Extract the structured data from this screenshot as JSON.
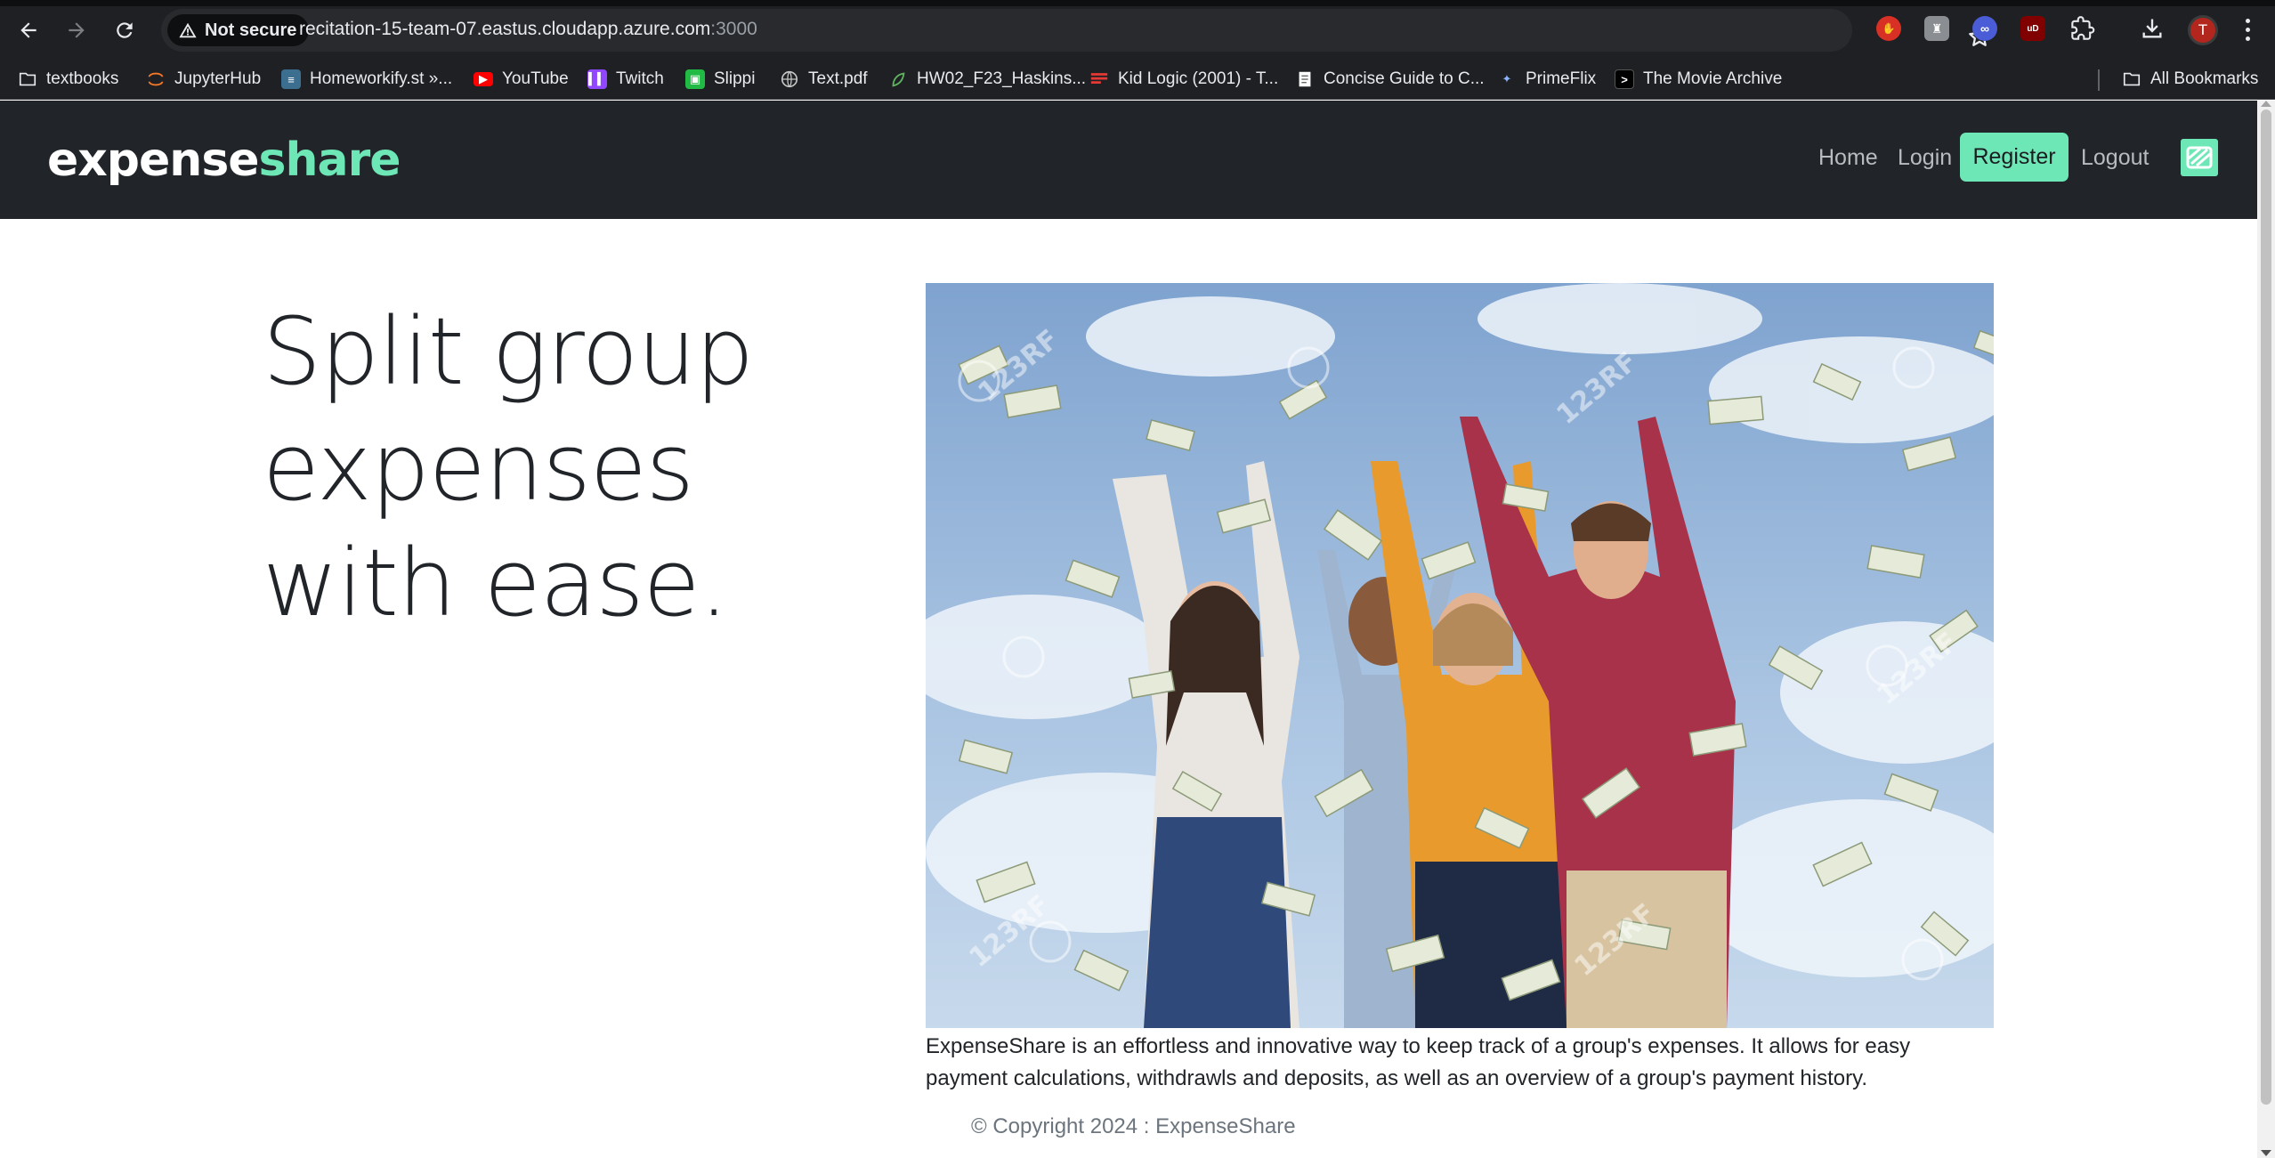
{
  "browser": {
    "security_label": "Not secure",
    "url_host": "recitation-15-team-07.eastus.cloudapp.azure.com",
    "url_port": ":3000",
    "avatar_letter": "T",
    "bookmarks": [
      {
        "label": "textbooks",
        "icon": "folder-icon"
      },
      {
        "label": "JupyterHub",
        "icon": "jupyter-icon"
      },
      {
        "label": "Homeworkify.st »...",
        "icon": "books-icon"
      },
      {
        "label": "YouTube",
        "icon": "youtube-icon"
      },
      {
        "label": "Twitch",
        "icon": "twitch-icon"
      },
      {
        "label": "Slippi",
        "icon": "slippi-icon"
      },
      {
        "label": "Text.pdf",
        "icon": "globe-icon"
      },
      {
        "label": "HW02_F23_Haskins...",
        "icon": "leaf-icon"
      },
      {
        "label": "Kid Logic (2001) - T...",
        "icon": "flag-icon"
      },
      {
        "label": "Concise Guide to C...",
        "icon": "document-icon"
      },
      {
        "label": "PrimeFlix",
        "icon": "primeflix-icon"
      },
      {
        "label": "The Movie Archive",
        "icon": "terminal-icon"
      }
    ],
    "all_bookmarks_label": "All Bookmarks"
  },
  "site": {
    "brand_part1": "expense",
    "brand_part2": "share",
    "nav": {
      "home": "Home",
      "login": "Login",
      "register": "Register",
      "logout": "Logout"
    },
    "accent_color": "#6ee7b7",
    "header_bg": "#212529"
  },
  "main": {
    "hero_heading": "Split group expenses with ease.",
    "image_watermark": "123RF",
    "description": "ExpenseShare is an effortless and innovative way to keep track of a group's expenses. It allows for easy payment calculations, withdrawls and deposits, as well as an overview of a group's payment history.",
    "copyright": "© Copyright 2024 : ExpenseShare"
  }
}
